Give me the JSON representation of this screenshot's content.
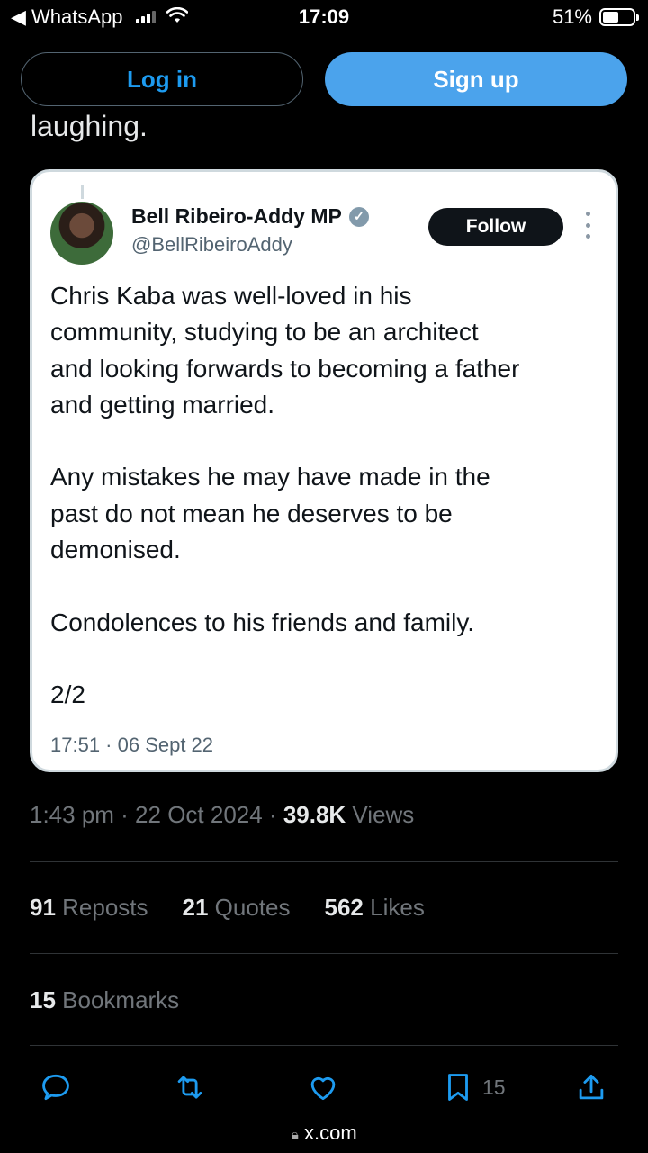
{
  "status_bar": {
    "back_app": "◀ WhatsApp",
    "time": "17:09",
    "battery": "51%"
  },
  "header": {
    "login_label": "Log in",
    "signup_label": "Sign up"
  },
  "previous_text": "laughing.",
  "quoted_tweet": {
    "author_name": "Bell Ribeiro-Addy MP",
    "handle": "@BellRibeiroAddy",
    "follow_label": "Follow",
    "paragraphs": [
      "Chris Kaba was well-loved in his\ncommunity, studying to be an architect\nand looking forwards to becoming a father\nand getting married.",
      "Any mistakes he may have made in the\npast do not mean he deserves to be\ndemonised.",
      "Condolences to his friends and family.",
      "2/2"
    ],
    "timestamp": "17:51 · 06 Sept 22"
  },
  "post_meta": {
    "time_date": "1:43 pm · 22 Oct 2024 · ",
    "views_count": "39.8K",
    "views_label": " Views"
  },
  "stats": {
    "reposts_count": "91",
    "reposts_label": " Reposts",
    "quotes_count": "21",
    "quotes_label": " Quotes",
    "likes_count": "562",
    "likes_label": " Likes",
    "bookmarks_count": "15",
    "bookmarks_label": " Bookmarks"
  },
  "actions": {
    "icons": [
      "reply-icon",
      "repost-icon",
      "like-icon",
      "bookmark-icon",
      "share-icon"
    ],
    "bookmark_count": "15"
  },
  "browser": {
    "url": "x.com"
  },
  "colors": {
    "accent": "#1d9bf0",
    "signup_bg": "#4ba3ec",
    "muted": "#71767b",
    "divider": "#2f3336"
  }
}
